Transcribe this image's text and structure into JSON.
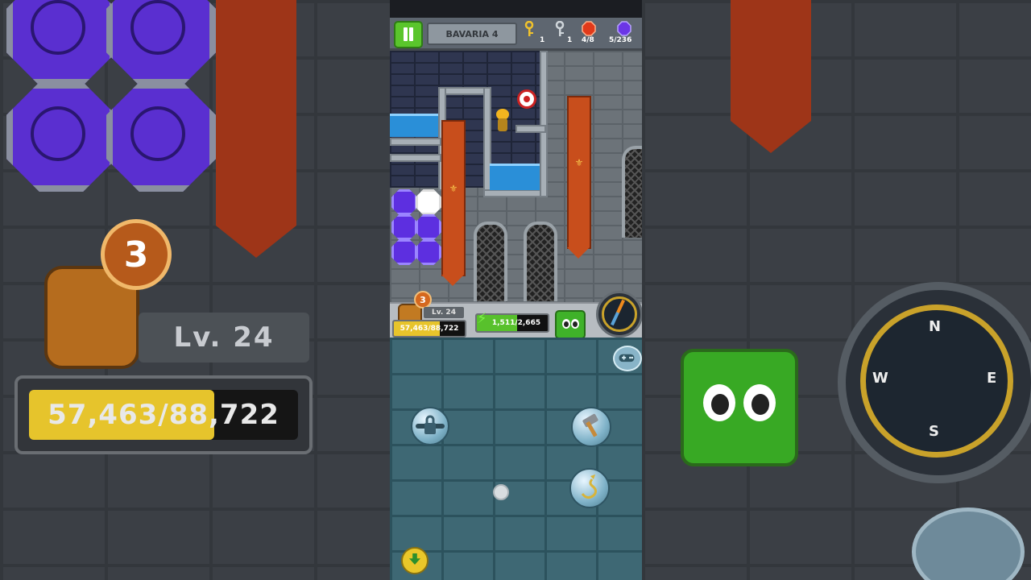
{
  "hud_top": {
    "level_name": "BAVARIA 4",
    "gold_keys": "1",
    "silver_keys": "1",
    "red_gems": "4/8",
    "purple_gems": "5/236"
  },
  "player": {
    "bag_count": "3",
    "level": "Lv. 24",
    "xp": "57,463/88,722",
    "xp_fraction": 0.648,
    "energy": "1,511/2,665",
    "energy_fraction": 0.567
  },
  "background": {
    "bag_count": "3",
    "level": "Lv. 24",
    "xp": "57,463/88,722",
    "compass": {
      "n": "N",
      "s": "S",
      "e": "E",
      "w": "W"
    }
  },
  "icons": [
    "pause-icon",
    "gold-key-icon",
    "silver-key-icon",
    "red-gem-icon",
    "purple-gem-icon",
    "bag-icon",
    "energy-bolt-icon",
    "eyes-icon",
    "compass-icon",
    "gamepad-icon",
    "locked-chain-icon",
    "hammer-icon",
    "hook-icon",
    "download-icon"
  ],
  "colors": {
    "accent_green": "#3fb229",
    "banner_red": "#c84e1c",
    "gem_purple": "#5d2fe0",
    "water_blue": "#2a8fd8"
  }
}
